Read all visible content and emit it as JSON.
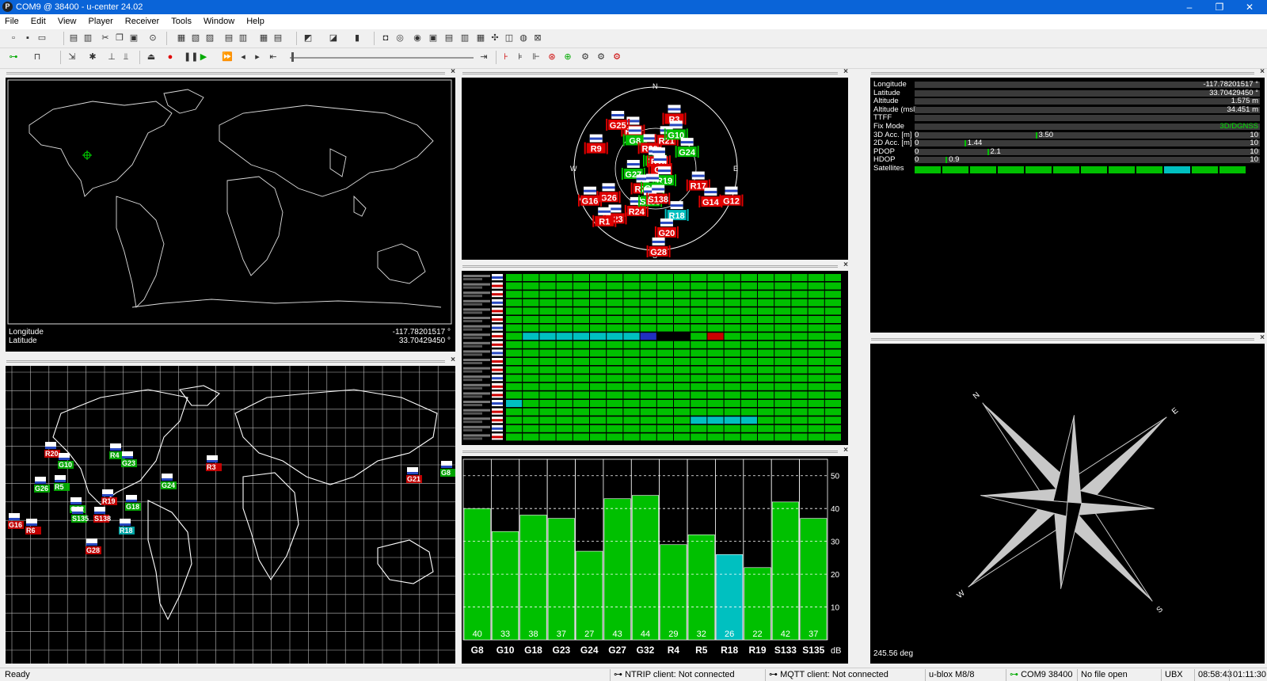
{
  "window": {
    "title": "COM9 @ 38400 - u-center 24.02",
    "icon": "P",
    "minimize": "–",
    "restore": "❐",
    "close": "✕"
  },
  "menu": [
    "File",
    "Edit",
    "View",
    "Player",
    "Receiver",
    "Tools",
    "Window",
    "Help"
  ],
  "panels": {
    "world_map": {
      "longitude_label": "Longitude",
      "longitude_value": "-117.78201517 °",
      "latitude_label": "Latitude",
      "latitude_value": "33.70429450 °"
    },
    "navigation": {
      "rows": [
        {
          "label": "Longitude",
          "value": "-117.78201517 °"
        },
        {
          "label": "Latitude",
          "value": "33.70429450 °"
        },
        {
          "label": "Altitude",
          "value": "1.575 m"
        },
        {
          "label": "Altitude (msl)",
          "value": "34.451 m"
        },
        {
          "label": "TTFF",
          "value": ""
        },
        {
          "label": "Fix Mode",
          "value": "3D/DGNSS"
        }
      ],
      "gauges": [
        {
          "label": "3D Acc. [m]",
          "min": "0",
          "max": "10",
          "value": "3.50",
          "level": 0.35
        },
        {
          "label": "2D Acc. [m]",
          "min": "0",
          "max": "10",
          "value": "1.44",
          "level": 0.144
        },
        {
          "label": "PDOP",
          "min": "0",
          "max": "10",
          "value": "2.1",
          "level": 0.21
        },
        {
          "label": "HDOP",
          "min": "0",
          "max": "10",
          "value": "0.9",
          "level": 0.09
        }
      ],
      "satellites_label": "Satellites"
    },
    "sky_view": {
      "north": "N",
      "south": "S",
      "east": "E",
      "west": "W",
      "sats": [
        {
          "id": "R3",
          "az": 20,
          "el": 30,
          "used": false
        },
        {
          "id": "R14",
          "az": 330,
          "el": 40,
          "used": false
        },
        {
          "id": "G25",
          "az": 320,
          "el": 25,
          "used": false
        },
        {
          "id": "G8",
          "az": 325,
          "el": 50,
          "used": true
        },
        {
          "id": "R20",
          "az": 345,
          "el": 65,
          "used": false
        },
        {
          "id": "R21",
          "az": 20,
          "el": 55,
          "used": false
        },
        {
          "id": "G10",
          "az": 30,
          "el": 45,
          "used": true
        },
        {
          "id": "G18",
          "az": 355,
          "el": 80,
          "used": true
        },
        {
          "id": "R13",
          "az": 20,
          "el": 80,
          "used": false
        },
        {
          "id": "G24",
          "az": 60,
          "el": 50,
          "used": true
        },
        {
          "id": "G6",
          "az": 80,
          "el": 85,
          "used": false
        },
        {
          "id": "R9",
          "az": 290,
          "el": 20,
          "used": false
        },
        {
          "id": "G27",
          "az": 260,
          "el": 65,
          "used": true
        },
        {
          "id": "G26",
          "az": 240,
          "el": 30,
          "used": false
        },
        {
          "id": "R22",
          "az": 215,
          "el": 65,
          "used": false
        },
        {
          "id": "R19",
          "az": 140,
          "el": 75,
          "used": true
        },
        {
          "id": "G32",
          "az": 190,
          "el": 70,
          "used": true
        },
        {
          "id": "R17",
          "az": 110,
          "el": 40,
          "used": false
        },
        {
          "id": "G16",
          "az": 245,
          "el": 10,
          "used": false
        },
        {
          "id": "R24",
          "az": 205,
          "el": 40,
          "used": false
        },
        {
          "id": "S133",
          "az": 190,
          "el": 55,
          "used": true
        },
        {
          "id": "S138",
          "az": 175,
          "el": 58,
          "used": false
        },
        {
          "id": "R18",
          "az": 155,
          "el": 35,
          "used": true
        },
        {
          "id": "G14",
          "az": 120,
          "el": 20,
          "used": false
        },
        {
          "id": "G12",
          "az": 112,
          "el": 0,
          "used": false
        },
        {
          "id": "R23",
          "az": 220,
          "el": 20,
          "used": false
        },
        {
          "id": "R1",
          "az": 225,
          "el": 10,
          "used": false
        },
        {
          "id": "G20",
          "az": 170,
          "el": 20,
          "used": false
        },
        {
          "id": "G28",
          "az": 178,
          "el": 0,
          "used": false
        }
      ]
    },
    "signal_chart": {
      "unit": "dB",
      "ticks": [
        "10",
        "20",
        "30",
        "40",
        "50"
      ]
    },
    "compass": {
      "heading": "245.56 deg",
      "n": "N",
      "s": "S",
      "e": "E",
      "w": "W"
    }
  },
  "chart_data": {
    "type": "bar",
    "categories": [
      "G8",
      "G10",
      "G18",
      "G23",
      "G24",
      "G27",
      "G32",
      "R4",
      "R5",
      "R18",
      "R19",
      "S133",
      "S135"
    ],
    "values": [
      40,
      33,
      38,
      37,
      27,
      43,
      44,
      29,
      32,
      26,
      22,
      42,
      37
    ],
    "ylabel": "dB",
    "ylim": [
      0,
      55
    ],
    "colors": {
      "used": "#00c000",
      "partial": "#00c0c0"
    }
  },
  "status": {
    "ready": "Ready",
    "ntrip": "NTRIP client: Not connected",
    "mqtt": "MQTT client: Not connected",
    "receiver": "u-blox M8/8",
    "port": "COM9 38400",
    "file": "No file open",
    "protocol": "UBX",
    "time1": "08:58:43",
    "time2": "01:11:30"
  },
  "colors": {
    "titlebar": "#0a64d8",
    "used_green": "#00c000",
    "cyan": "#00c0c0",
    "sat_red": "#e00000"
  }
}
